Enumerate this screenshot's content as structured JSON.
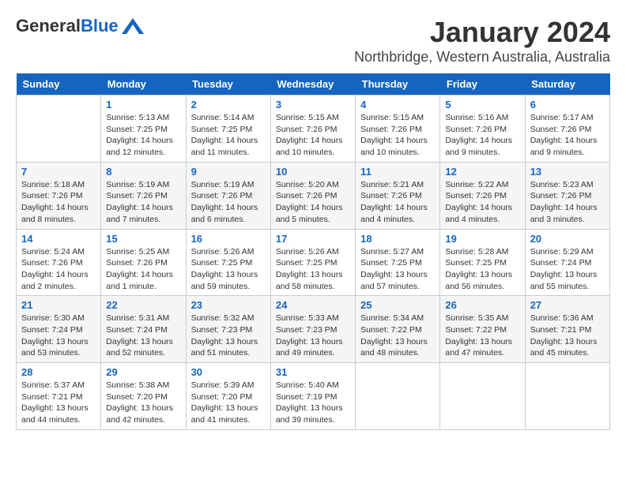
{
  "header": {
    "logo_general": "General",
    "logo_blue": "Blue",
    "title": "January 2024",
    "subtitle": "Northbridge, Western Australia, Australia"
  },
  "calendar": {
    "weekdays": [
      "Sunday",
      "Monday",
      "Tuesday",
      "Wednesday",
      "Thursday",
      "Friday",
      "Saturday"
    ],
    "weeks": [
      [
        {
          "day": "",
          "info": ""
        },
        {
          "day": "1",
          "info": "Sunrise: 5:13 AM\nSunset: 7:25 PM\nDaylight: 14 hours\nand 12 minutes."
        },
        {
          "day": "2",
          "info": "Sunrise: 5:14 AM\nSunset: 7:25 PM\nDaylight: 14 hours\nand 11 minutes."
        },
        {
          "day": "3",
          "info": "Sunrise: 5:15 AM\nSunset: 7:26 PM\nDaylight: 14 hours\nand 10 minutes."
        },
        {
          "day": "4",
          "info": "Sunrise: 5:15 AM\nSunset: 7:26 PM\nDaylight: 14 hours\nand 10 minutes."
        },
        {
          "day": "5",
          "info": "Sunrise: 5:16 AM\nSunset: 7:26 PM\nDaylight: 14 hours\nand 9 minutes."
        },
        {
          "day": "6",
          "info": "Sunrise: 5:17 AM\nSunset: 7:26 PM\nDaylight: 14 hours\nand 9 minutes."
        }
      ],
      [
        {
          "day": "7",
          "info": "Sunrise: 5:18 AM\nSunset: 7:26 PM\nDaylight: 14 hours\nand 8 minutes."
        },
        {
          "day": "8",
          "info": "Sunrise: 5:19 AM\nSunset: 7:26 PM\nDaylight: 14 hours\nand 7 minutes."
        },
        {
          "day": "9",
          "info": "Sunrise: 5:19 AM\nSunset: 7:26 PM\nDaylight: 14 hours\nand 6 minutes."
        },
        {
          "day": "10",
          "info": "Sunrise: 5:20 AM\nSunset: 7:26 PM\nDaylight: 14 hours\nand 5 minutes."
        },
        {
          "day": "11",
          "info": "Sunrise: 5:21 AM\nSunset: 7:26 PM\nDaylight: 14 hours\nand 4 minutes."
        },
        {
          "day": "12",
          "info": "Sunrise: 5:22 AM\nSunset: 7:26 PM\nDaylight: 14 hours\nand 4 minutes."
        },
        {
          "day": "13",
          "info": "Sunrise: 5:23 AM\nSunset: 7:26 PM\nDaylight: 14 hours\nand 3 minutes."
        }
      ],
      [
        {
          "day": "14",
          "info": "Sunrise: 5:24 AM\nSunset: 7:26 PM\nDaylight: 14 hours\nand 2 minutes."
        },
        {
          "day": "15",
          "info": "Sunrise: 5:25 AM\nSunset: 7:26 PM\nDaylight: 14 hours\nand 1 minute."
        },
        {
          "day": "16",
          "info": "Sunrise: 5:26 AM\nSunset: 7:25 PM\nDaylight: 13 hours\nand 59 minutes."
        },
        {
          "day": "17",
          "info": "Sunrise: 5:26 AM\nSunset: 7:25 PM\nDaylight: 13 hours\nand 58 minutes."
        },
        {
          "day": "18",
          "info": "Sunrise: 5:27 AM\nSunset: 7:25 PM\nDaylight: 13 hours\nand 57 minutes."
        },
        {
          "day": "19",
          "info": "Sunrise: 5:28 AM\nSunset: 7:25 PM\nDaylight: 13 hours\nand 56 minutes."
        },
        {
          "day": "20",
          "info": "Sunrise: 5:29 AM\nSunset: 7:24 PM\nDaylight: 13 hours\nand 55 minutes."
        }
      ],
      [
        {
          "day": "21",
          "info": "Sunrise: 5:30 AM\nSunset: 7:24 PM\nDaylight: 13 hours\nand 53 minutes."
        },
        {
          "day": "22",
          "info": "Sunrise: 5:31 AM\nSunset: 7:24 PM\nDaylight: 13 hours\nand 52 minutes."
        },
        {
          "day": "23",
          "info": "Sunrise: 5:32 AM\nSunset: 7:23 PM\nDaylight: 13 hours\nand 51 minutes."
        },
        {
          "day": "24",
          "info": "Sunrise: 5:33 AM\nSunset: 7:23 PM\nDaylight: 13 hours\nand 49 minutes."
        },
        {
          "day": "25",
          "info": "Sunrise: 5:34 AM\nSunset: 7:22 PM\nDaylight: 13 hours\nand 48 minutes."
        },
        {
          "day": "26",
          "info": "Sunrise: 5:35 AM\nSunset: 7:22 PM\nDaylight: 13 hours\nand 47 minutes."
        },
        {
          "day": "27",
          "info": "Sunrise: 5:36 AM\nSunset: 7:21 PM\nDaylight: 13 hours\nand 45 minutes."
        }
      ],
      [
        {
          "day": "28",
          "info": "Sunrise: 5:37 AM\nSunset: 7:21 PM\nDaylight: 13 hours\nand 44 minutes."
        },
        {
          "day": "29",
          "info": "Sunrise: 5:38 AM\nSunset: 7:20 PM\nDaylight: 13 hours\nand 42 minutes."
        },
        {
          "day": "30",
          "info": "Sunrise: 5:39 AM\nSunset: 7:20 PM\nDaylight: 13 hours\nand 41 minutes."
        },
        {
          "day": "31",
          "info": "Sunrise: 5:40 AM\nSunset: 7:19 PM\nDaylight: 13 hours\nand 39 minutes."
        },
        {
          "day": "",
          "info": ""
        },
        {
          "day": "",
          "info": ""
        },
        {
          "day": "",
          "info": ""
        }
      ]
    ]
  }
}
